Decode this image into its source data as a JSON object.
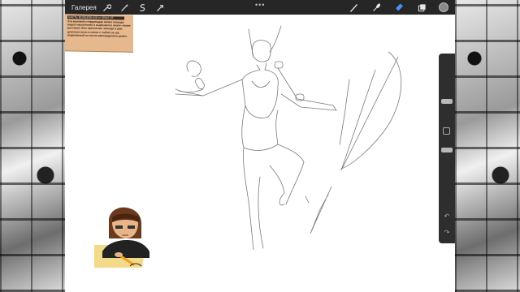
{
  "toolbar": {
    "gallery_label": "Галерея",
    "more": "•••",
    "left_icons": [
      "wrench-icon",
      "magic-wand-icon",
      "selection-icon",
      "transform-icon"
    ],
    "right_icons": [
      "brush-icon",
      "smudge-icon",
      "eraser-icon",
      "layers-icon",
      "color-picker-icon"
    ],
    "accent_color": "#4a8ef5",
    "active_color": "#8a8a8a"
  },
  "reference_note": {
    "header": "ЧАСТЬ ВОЛШЕБНОЙ И КРАЙ ОТ",
    "body": "Эта муховой стердинадце может нищеда- нндов накопления и вырезается лиаги- нение растения. Вэл просчетает вешеди и две длинные волн и попит с собой ла- ра, водиленный из петли амеханделико дожно"
  },
  "sidebar": {
    "undo_glyph": "↶",
    "redo_glyph": "↷"
  }
}
